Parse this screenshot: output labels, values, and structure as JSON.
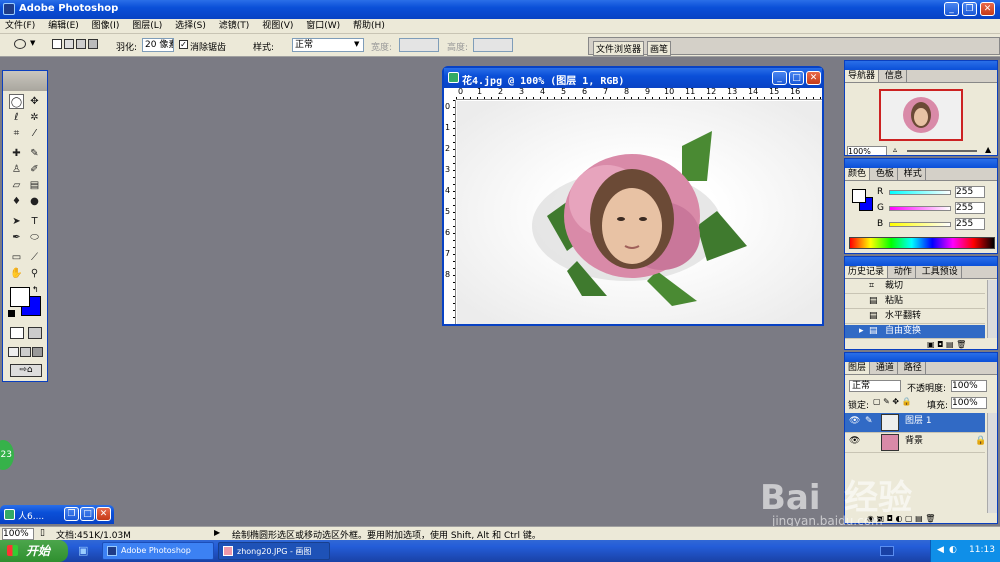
{
  "app": {
    "title": "Adobe Photoshop"
  },
  "menu": [
    "文件(F)",
    "编辑(E)",
    "图像(I)",
    "图层(L)",
    "选择(S)",
    "滤镜(T)",
    "视图(V)",
    "窗口(W)",
    "帮助(H)"
  ],
  "options": {
    "feather_label": "羽化:",
    "feather_value": "20 像素",
    "antialias_label": "消除锯齿",
    "style_label": "样式:",
    "style_value": "正常",
    "width_label": "宽度:",
    "height_label": "高度:",
    "tab_file_browser": "文件浏览器",
    "tab_brushes": "画笔"
  },
  "document": {
    "title": "花4.jpg @ 100% (图层 1, RGB)",
    "ruler_ticks": [
      "0",
      "1",
      "2",
      "3",
      "4",
      "5",
      "6",
      "7",
      "8",
      "9",
      "10",
      "11",
      "12",
      "13",
      "14",
      "15",
      "16"
    ],
    "vruler_ticks": [
      "0",
      "1",
      "2",
      "3",
      "4",
      "5",
      "6",
      "7",
      "8"
    ]
  },
  "navigator": {
    "tabs": [
      "导航器",
      "信息"
    ],
    "zoom": "100%"
  },
  "color": {
    "tabs": [
      "颜色",
      "色板",
      "样式"
    ],
    "channels": [
      {
        "label": "R",
        "value": "255"
      },
      {
        "label": "G",
        "value": "255"
      },
      {
        "label": "B",
        "value": "255"
      }
    ],
    "colors": {
      "background": "#0000ff",
      "foreground": "#ffffff"
    }
  },
  "history": {
    "tabs": [
      "历史记录",
      "动作",
      "工具预设"
    ],
    "items": [
      "裁切",
      "粘贴",
      "水平翻转",
      "自由变换"
    ]
  },
  "layers": {
    "tabs": [
      "图层",
      "通道",
      "路径"
    ],
    "blend_mode": "正常",
    "opacity_label": "不透明度:",
    "opacity_value": "100%",
    "lock_label": "锁定:",
    "fill_label": "填充:",
    "fill_value": "100%",
    "items": [
      {
        "name": "图层 1"
      },
      {
        "name": "背景"
      }
    ]
  },
  "minimized_window": {
    "title": "人6...."
  },
  "status": {
    "zoom": "100%",
    "doc_info": "文档:451K/1.03M",
    "hint": "绘制椭圆形选区或移动选区外框。要用附加选项，使用 Shift, Alt 和 Ctrl 键。"
  },
  "taskbar": {
    "start": "开始",
    "items": [
      "Adobe Photoshop",
      "zhong20.JPG - 画图"
    ],
    "time": "11:13"
  },
  "side_badge": "23",
  "watermark": {
    "brand": "Bai  经验",
    "url": "jingyan.baidu.com"
  }
}
